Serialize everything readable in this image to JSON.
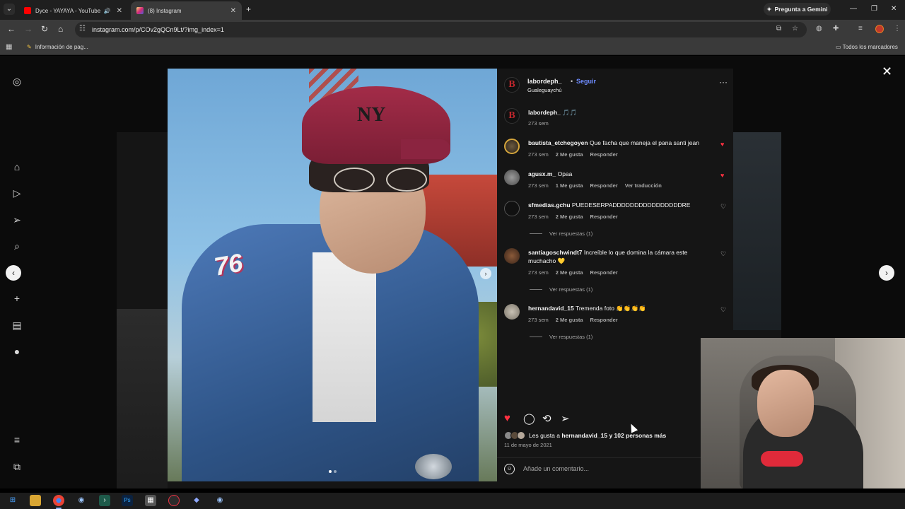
{
  "browser": {
    "tabs": [
      {
        "title": "Dyce - YAYAYA - YouTube",
        "favicon_color": "#ff0000"
      },
      {
        "title": "(8) Instagram",
        "favicon_color": "#d62976"
      }
    ],
    "gemini_label": "Pregunta a Gemini",
    "url": "instagram.com/p/COv2gQCn9Lt/?img_index=1",
    "bookmark": "Información de pag...",
    "all_bookmarks": "Todos los marcadores"
  },
  "post": {
    "author": "labordeph_",
    "follow_label": "Seguir",
    "location": "Gualeguaychú",
    "avatar_letter": "B",
    "caption_user": "labordeph_",
    "caption_text": "🎵🎵",
    "caption_time": "273 sem",
    "patch_text": "76",
    "cap_logo": "NY",
    "comments": [
      {
        "user": "bautista_etchegoyen",
        "text": "Que facha que maneja el pana santi jean",
        "time": "273 sem",
        "likes": "2 Me gusta",
        "reply": "Responder",
        "liked": true
      },
      {
        "user": "agusx.m_",
        "text": "Opaa",
        "time": "273 sem",
        "likes": "1 Me gusta",
        "reply": "Responder",
        "translate": "Ver traducción",
        "liked": true
      },
      {
        "user": "sfmedias.gchu",
        "text": "PUEDESERPADDDDDDDDDDDDDDDDRE",
        "time": "273 sem",
        "likes": "2 Me gusta",
        "reply": "Responder",
        "replies": "Ver respuestas (1)"
      },
      {
        "user": "santiagoschwindt7",
        "text": "Increíble lo que domina la cámara este muchacho 💛",
        "time": "273 sem",
        "likes": "2 Me gusta",
        "reply": "Responder",
        "replies": "Ver respuestas (1)"
      },
      {
        "user": "hernandavid_15",
        "text": "Tremenda foto 👏👏👏👏",
        "time": "273 sem",
        "likes": "2 Me gusta",
        "reply": "Responder",
        "replies": "Ver respuestas (1)"
      }
    ],
    "likes_text_prefix": "Les gusta a",
    "likes_user": "hernandavid_15",
    "likes_text_suffix": "y 102 personas más",
    "date": "11 de mayo de 2021",
    "add_comment_placeholder": "Añade un comentario..."
  },
  "icons": {
    "heart_filled": "♥",
    "heart_empty": "♡"
  },
  "colors": {
    "accent_blue": "#6f8cff",
    "like_red": "#ff3040",
    "panel_bg": "#151515"
  }
}
